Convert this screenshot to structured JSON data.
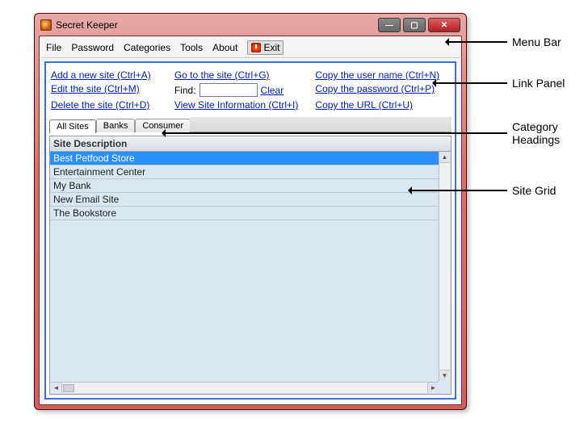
{
  "window": {
    "title": "Secret Keeper"
  },
  "winbtns": {
    "min": "—",
    "max": "▢",
    "close": "✕"
  },
  "menu": {
    "file": "File",
    "password": "Password",
    "categories": "Categories",
    "tools": "Tools",
    "about": "About",
    "exit": "Exit"
  },
  "links": {
    "add": "Add a new site (Ctrl+A)",
    "edit": "Edit the site (Ctrl+M)",
    "delete": "Delete the site (Ctrl+D)",
    "go": "Go to the site (Ctrl+G)",
    "find_label": "Find:",
    "clear": "Clear",
    "viewinfo": "View Site Information (Ctrl+I)",
    "copyuser": "Copy the user name (Ctrl+N)",
    "copypass": "Copy the password (Ctrl+P)",
    "copyurl": "Copy the URL (Ctrl+U)"
  },
  "find": {
    "value": "",
    "placeholder": ""
  },
  "tabs": {
    "all": "All Sites",
    "banks": "Banks",
    "consumer": "Consumer"
  },
  "grid": {
    "header": "Site Description",
    "rows": [
      "Best Petfood Store",
      "Entertainment Center",
      "My Bank",
      "New Email Site",
      "The Bookstore"
    ],
    "selected_index": 0
  },
  "annotations": {
    "menubar": "Menu Bar",
    "linkpanel": "Link Panel",
    "categories": "Category\nHeadings",
    "sitegrid": "Site Grid"
  }
}
